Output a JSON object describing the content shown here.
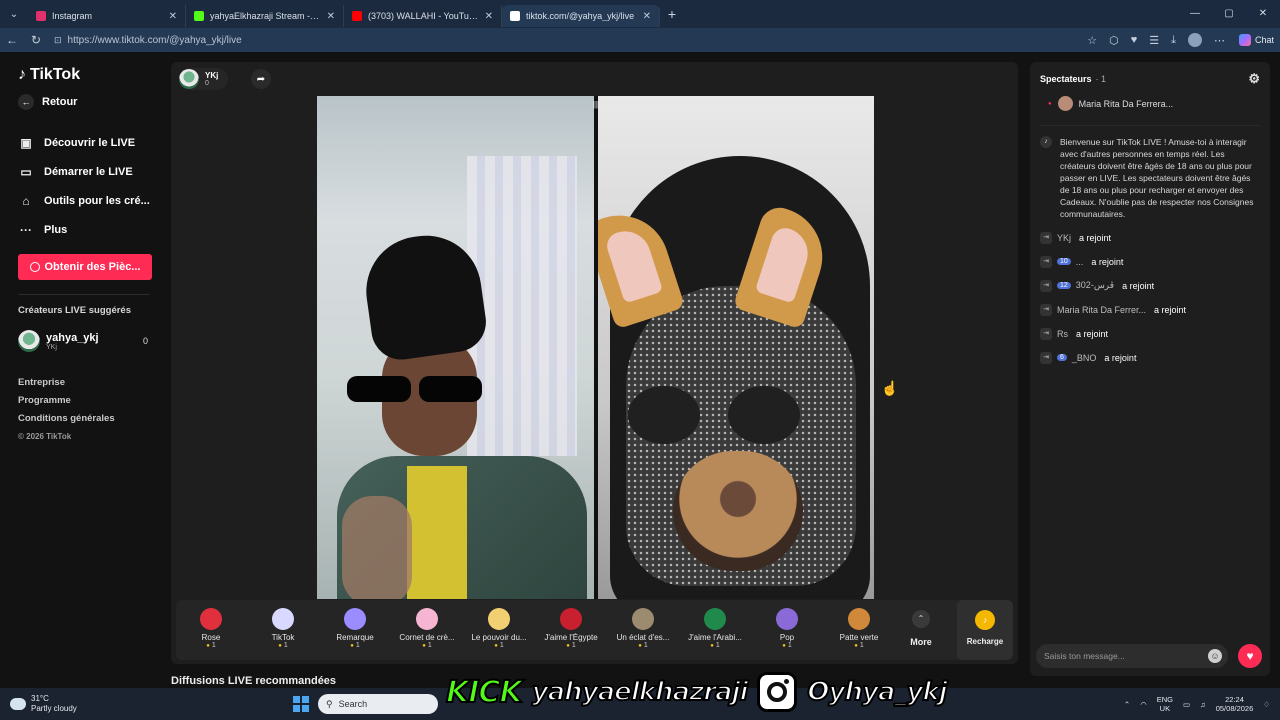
{
  "browser": {
    "tabs": [
      {
        "title": "Instagram",
        "color": "#e1306c"
      },
      {
        "title": "yahyaElkhazraji Stream - Watch Li",
        "color": "#53fc18"
      },
      {
        "title": "(3703) WALLAHI - YouTube",
        "color": "#ff0000"
      },
      {
        "title": "tiktok.com/@yahya_ykj/live",
        "color": "#ffffff"
      }
    ],
    "url": "https://www.tiktok.com/@yahya_ykj/live",
    "chat_label": "Chat"
  },
  "sidebar": {
    "logo": "TikTok",
    "back": "Retour",
    "nav": [
      {
        "label": "Découvrir le LIVE",
        "icon": "grid-icon",
        "glyph": "▣"
      },
      {
        "label": "Démarrer le LIVE",
        "icon": "camera-icon",
        "glyph": "▭"
      },
      {
        "label": "Outils pour les cré...",
        "icon": "tools-icon",
        "glyph": "⌂"
      },
      {
        "label": "Plus",
        "icon": "more-icon",
        "glyph": "···"
      }
    ],
    "coins_button": "Obtenir des Pièc...",
    "suggested_title": "Créateurs LIVE suggérés",
    "creator": {
      "name": "yahya_ykj",
      "sub": "YKj",
      "count": "0"
    },
    "footer": [
      "Entreprise",
      "Programme",
      "Conditions générales"
    ],
    "copyright": "© 2026 TikTok"
  },
  "live": {
    "host_name": "YKj",
    "host_likes": "0",
    "gifts": [
      {
        "label": "Rose",
        "price": "1",
        "color": "#e0303e"
      },
      {
        "label": "TikTok",
        "price": "1",
        "color": "#d9d9ff"
      },
      {
        "label": "Remarque",
        "price": "1",
        "color": "#9b8cff"
      },
      {
        "label": "Cornet de crè...",
        "price": "1",
        "color": "#f6b6d3"
      },
      {
        "label": "Le pouvoir du...",
        "price": "1",
        "color": "#f2d072"
      },
      {
        "label": "J'aime l'Égypte",
        "price": "1",
        "color": "#c8202e"
      },
      {
        "label": "Un éclat d'es...",
        "price": "1",
        "color": "#9d8b6f"
      },
      {
        "label": "J'aime l'Arabi...",
        "price": "1",
        "color": "#1f8a4c"
      },
      {
        "label": "Pop",
        "price": "1",
        "color": "#8a6ad6"
      },
      {
        "label": "Patte verte",
        "price": "1",
        "color": "#d0883a"
      }
    ],
    "more_label": "More",
    "recharge_label": "Recharge"
  },
  "recommended_title": "Diffusions LIVE recommandées",
  "chat": {
    "title": "Spectateurs",
    "viewer_count": "· 1",
    "viewer_name": "Maria Rita Da Ferrera...",
    "welcome": "Bienvenue sur TikTok LIVE ! Amuse-toi à interagir avec d'autres personnes en temps réel. Les créateurs doivent être âgés de 18 ans ou plus pour passer en LIVE. Les spectateurs doivent être âgés de 18 ans ou plus pour recharger et envoyer des Cadeaux. N'oublie pas de respecter nos Consignes communautaires.",
    "joins": [
      {
        "badge": "",
        "user": "YKj",
        "action": "a rejoint"
      },
      {
        "badge": "10",
        "user": "...",
        "action": "a rejoint"
      },
      {
        "badge": "12",
        "user": "302-ڤرس",
        "action": "a rejoint"
      },
      {
        "badge": "",
        "user": "Maria Rita Da Ferrer...",
        "action": "a rejoint"
      },
      {
        "badge": "",
        "user": "Rs",
        "action": "a rejoint"
      },
      {
        "badge": "6",
        "user": "_BNO",
        "action": "a rejoint"
      }
    ],
    "input_placeholder": "Saisis ton message..."
  },
  "taskbar": {
    "temp": "31°C",
    "weather": "Partly cloudy",
    "search": "Search",
    "lang1": "ENG",
    "lang2": "UK",
    "time": "22:24",
    "date": "05/08/2026"
  },
  "overlay": {
    "kick": "KICK",
    "kick_handle": "yahyaelkhazraji",
    "ig_handle": "Oyhya_ykj"
  }
}
